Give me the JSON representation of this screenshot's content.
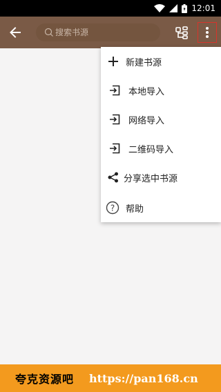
{
  "status_bar": {
    "time": "12:01"
  },
  "app_bar": {
    "search_placeholder": "搜索书源"
  },
  "menu": {
    "items": [
      {
        "label": "新建书源",
        "icon": "plus-icon"
      },
      {
        "label": "本地导入",
        "icon": "import-icon"
      },
      {
        "label": "网络导入",
        "icon": "import-icon"
      },
      {
        "label": "二维码导入",
        "icon": "import-icon"
      },
      {
        "label": "分享选中书源",
        "icon": "share-icon"
      },
      {
        "label": "帮助",
        "icon": "help-icon"
      }
    ]
  },
  "banner": {
    "brand": "夸克资源吧",
    "url": "https://pan168.cn"
  },
  "colors": {
    "app_bar": "#7a5a46",
    "highlight": "#d9342b",
    "banner": "#f39a1e"
  }
}
